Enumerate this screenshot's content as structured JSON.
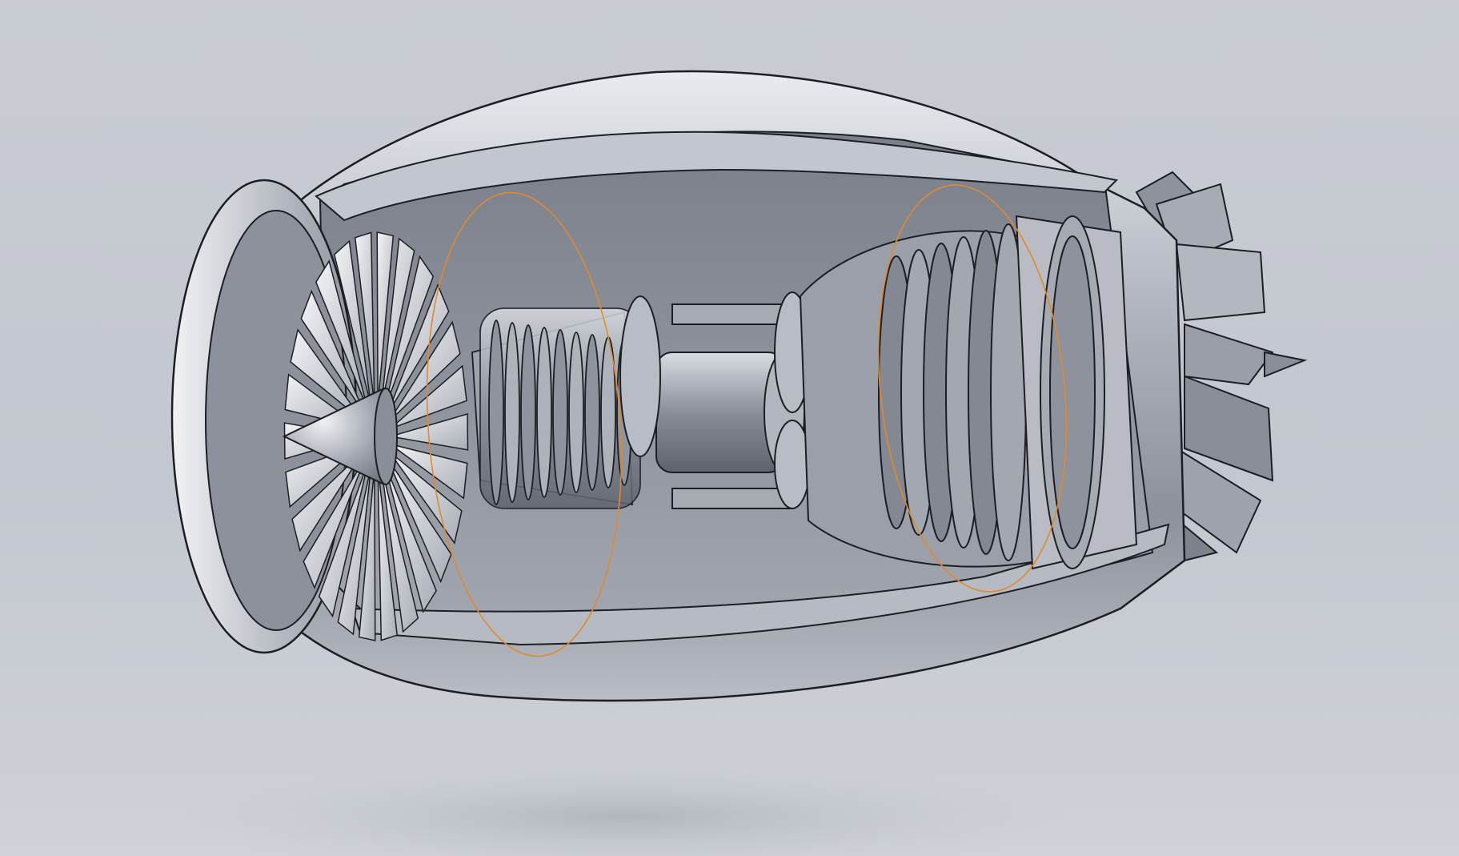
{
  "viewport": {
    "background": "#c6cad1",
    "model_color": "#9a9ea8",
    "edge_color": "#1c1e24",
    "highlight_color": "#e08a2c"
  },
  "model": {
    "component": "turbofan-engine-cutaway",
    "view": "isometric",
    "display_mode": "shaded-with-edges",
    "highlighted_regions": 2
  }
}
